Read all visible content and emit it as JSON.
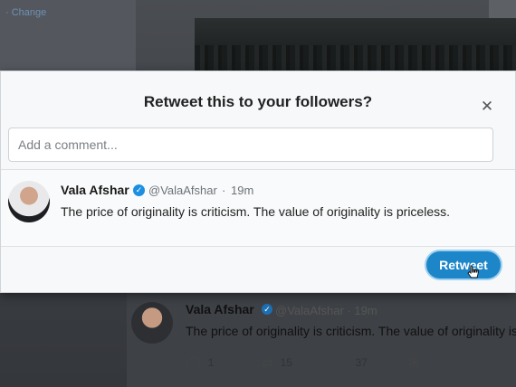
{
  "background": {
    "change_link": "· Change",
    "tweet": {
      "name": "Vala Afshar",
      "handle": "@ValaAfshar · 19m",
      "text": "The price of originality is criticism. The value of originality is",
      "reply_count": "1",
      "retweet_count": "15",
      "like_count": "37"
    }
  },
  "modal": {
    "title": "Retweet this to your followers?",
    "comment_placeholder": "Add a comment...",
    "tweet": {
      "name": "Vala Afshar",
      "handle": "@ValaAfshar",
      "separator": "·",
      "time": "19m",
      "text": "The price of originality is criticism. The value of originality is priceless."
    },
    "retweet_label": "Retweet",
    "close_symbol": "✕"
  },
  "icons": {
    "close": "close-icon",
    "verified": "verified-badge-icon",
    "reply": "reply-icon",
    "retweet": "retweet-icon",
    "like": "heart-icon",
    "message": "envelope-icon",
    "cursor": "hand-pointer-icon"
  },
  "colors": {
    "accent": "#1d86c9",
    "verified": "#1d8fe0"
  }
}
